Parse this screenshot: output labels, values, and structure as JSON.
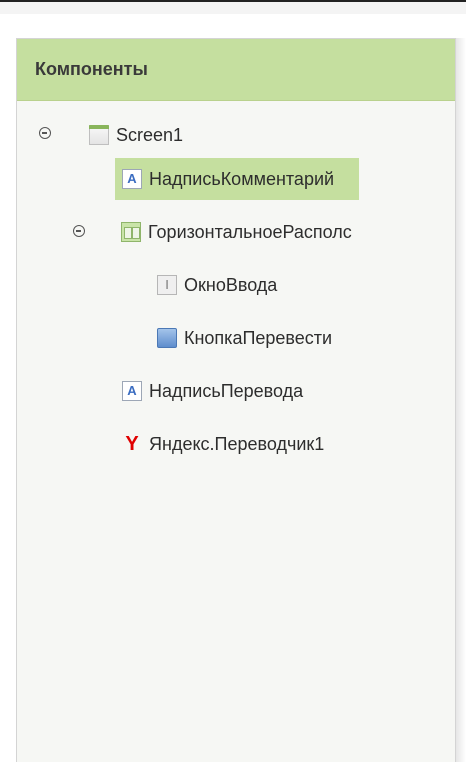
{
  "panel": {
    "title": "Компоненты"
  },
  "tree": {
    "screen": "Screen1",
    "items": [
      "НадписьКомментарий",
      "ГоризонтальноеРасполс",
      "ОкноВвода",
      "КнопкаПеревести",
      "НадписьПеревода",
      "Яндекс.Переводчик1"
    ]
  },
  "icons": {
    "label": "A",
    "textbox": "I",
    "yandex": "Y"
  },
  "colors": {
    "header_bg": "#c5df9f",
    "selection_bg": "#c5df9f",
    "yandex_red": "#e00000"
  },
  "state": {
    "selected": "НадписьКомментарий",
    "expanded": [
      "Screen1",
      "ГоризонтальноеРасполс"
    ]
  }
}
